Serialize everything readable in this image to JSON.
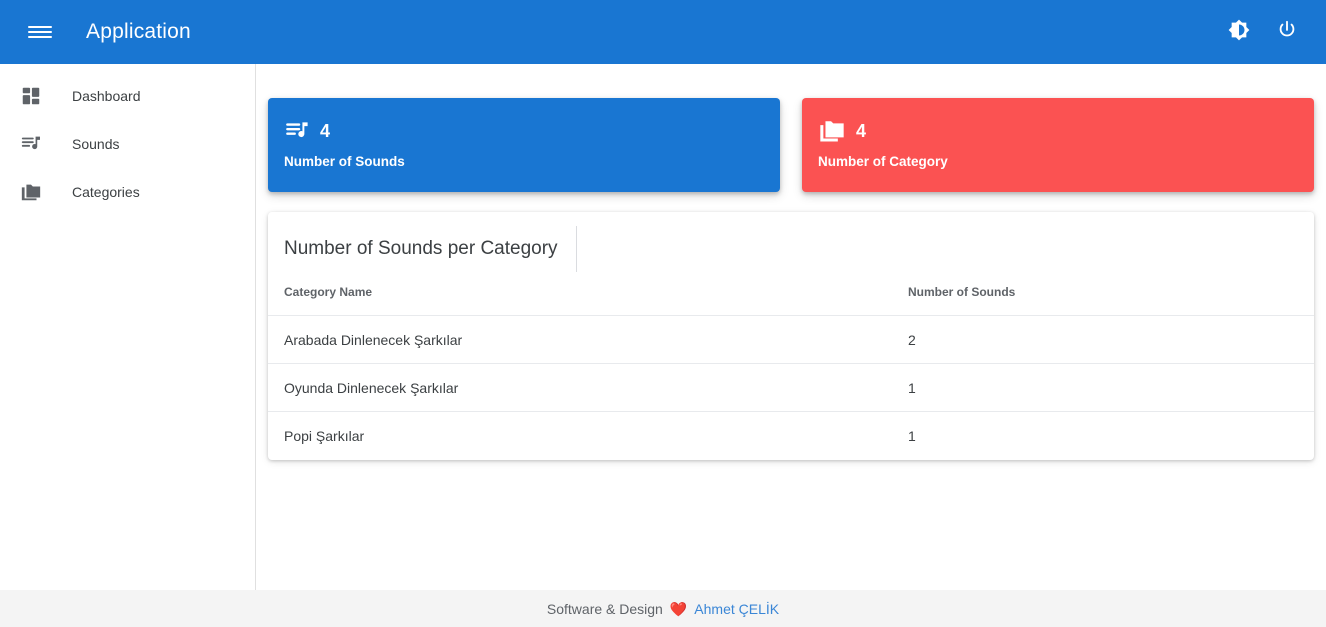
{
  "appbar": {
    "title": "Application",
    "menu_icon": "hamburger-menu-icon",
    "theme_icon": "brightness-contrast-icon",
    "logout_icon": "power-icon"
  },
  "sidebar": {
    "items": [
      {
        "label": "Dashboard",
        "icon": "dashboard-grid-icon"
      },
      {
        "label": "Sounds",
        "icon": "playlist-music-icon"
      },
      {
        "label": "Categories",
        "icon": "folder-copy-icon"
      }
    ]
  },
  "stats": [
    {
      "value": "4",
      "label": "Number of Sounds",
      "icon": "playlist-music-icon",
      "color": "#1976d2"
    },
    {
      "value": "4",
      "label": "Number of Category",
      "icon": "folder-copy-icon",
      "color": "#fb5252"
    }
  ],
  "table": {
    "title": "Number of Sounds per Category",
    "columns": [
      "Category Name",
      "Number of Sounds"
    ],
    "rows": [
      {
        "name": "Arabada Dinlenecek Şarkılar",
        "count": "2"
      },
      {
        "name": "Oyunda Dinlenecek Şarkılar",
        "count": "1"
      },
      {
        "name": "Popi Şarkılar",
        "count": "1"
      }
    ]
  },
  "footer": {
    "text": "Software & Design",
    "heart": "❤️",
    "author": "Ahmet ÇELİK",
    "link_color": "#3a86d6"
  }
}
